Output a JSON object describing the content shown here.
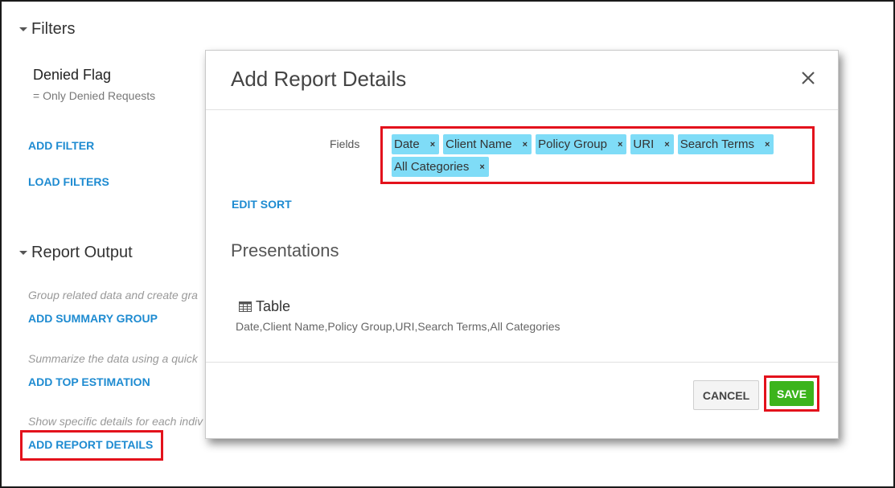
{
  "filters": {
    "heading": "Filters",
    "filter_name": "Denied Flag",
    "filter_desc": "= Only Denied Requests",
    "add_filter": "ADD FILTER",
    "load_filters": "LOAD FILTERS"
  },
  "report_output": {
    "heading": "Report Output",
    "hint_summary": "Group related data and create gra",
    "add_summary_group": "ADD SUMMARY GROUP",
    "hint_top": "Summarize the data using a quick",
    "add_top_estimation": "ADD TOP ESTIMATION",
    "hint_details": "Show specific details for each indiv",
    "add_report_details": "ADD REPORT DETAILS"
  },
  "modal": {
    "title": "Add Report Details",
    "fields_label": "Fields",
    "tags": [
      "Date",
      "Client Name",
      "Policy Group",
      "URI",
      "Search Terms",
      "All Categories"
    ],
    "tag_remove_glyph": "×",
    "edit_sort": "EDIT SORT",
    "presentations_title": "Presentations",
    "table_label": "Table",
    "table_fields": "Date,Client Name,Policy Group,URI,Search Terms,All Categories",
    "cancel_label": "CANCEL",
    "save_label": "SAVE"
  },
  "colors": {
    "link": "#1e8bd1",
    "tag_bg": "#7fdcf7",
    "highlight": "#e3121c",
    "save_bg": "#3cb41c"
  },
  "icons": {
    "section_toggle": "caret-down-icon",
    "close": "close-icon",
    "table": "table-grid-icon",
    "tag_remove": "remove-x-icon"
  }
}
